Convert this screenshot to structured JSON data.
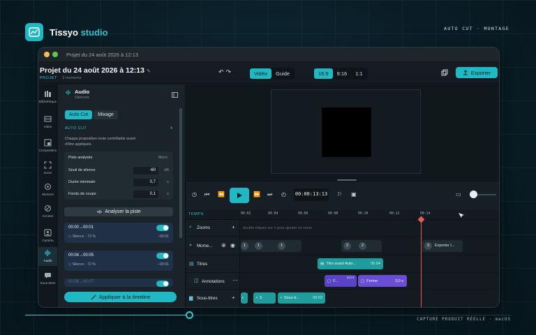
{
  "brand": {
    "name_main": "Tissyo",
    "name_accent": "studio"
  },
  "top_tag": "AUTO CUT · MONTAGE",
  "bottom_tag": "CAPTURE PRODUIT RÉELLE · macOS",
  "window": {
    "title": "Projet du 24 août 2026 à 12:13"
  },
  "header": {
    "project_title": "Projet du 24 août 2026 à 12:13",
    "project_tag": "PROJET",
    "project_meta": "3 moments",
    "view_tabs": [
      "Vidéo",
      "Guide"
    ],
    "active_view": "Vidéo",
    "ratios": [
      "16:9",
      "9:16",
      "1:1"
    ],
    "active_ratio": "16:9",
    "export_label": "Exporter"
  },
  "rail": [
    {
      "label": "Bibliothèque",
      "icon": "library-icon"
    },
    {
      "label": "Vidéo",
      "icon": "film-icon"
    },
    {
      "label": "Composition",
      "icon": "layout-icon"
    },
    {
      "label": "Zoom",
      "icon": "zoom-frame-icon"
    },
    {
      "label": "Moment",
      "icon": "target-icon"
    },
    {
      "label": "Annoter",
      "icon": "pen-icon"
    },
    {
      "label": "Caméra",
      "icon": "camera-icon"
    },
    {
      "label": "Audio",
      "icon": "audio-wave-icon"
    },
    {
      "label": "Sous-titres",
      "icon": "subtitles-icon"
    }
  ],
  "panel": {
    "title": "Audio",
    "subtitle": "Silences",
    "tabs": [
      "Auto Cut",
      "Mixage"
    ],
    "active_tab": "Auto Cut",
    "section_label": "AUTO CUT",
    "section_count": "4",
    "description": "Chaque proposition reste contrôlable avant d'être appliquée.",
    "track_label": "Piste analysée",
    "track_value": "Micro",
    "params": [
      {
        "label": "Seuil de silence",
        "value": "-60",
        "unit": "dB"
      },
      {
        "label": "Durée minimale",
        "value": "0,7",
        "unit": "s"
      },
      {
        "label": "Fondu de coupe",
        "value": "0,1",
        "unit": "s"
      }
    ],
    "analyse_label": "Analyser la piste",
    "segments": [
      {
        "time": "00:00→00:01",
        "type": "Silence · 72 %",
        "duration": "−00:01"
      },
      {
        "time": "00:04→00:05",
        "type": "Silence · 72 %",
        "duration": "−00:01"
      },
      {
        "time": "00:06→00:07",
        "type": "",
        "duration": ""
      }
    ],
    "apply_label": "Appliquer à la timeline"
  },
  "transport": {
    "timecode": "00:00:13:13",
    "zoom_level": 0.1
  },
  "timeline": {
    "header_label": "TEMPS",
    "ruler": [
      "00:02",
      "00:04",
      "00:06",
      "00:08",
      "00:10",
      "00:12",
      "00:14"
    ],
    "tracks": {
      "zooms": {
        "label": "Zooms",
        "hint": "double-cliquez sur + pour ajouter un zoom"
      },
      "moments": {
        "label": "Mome...",
        "numbers": [
          "1",
          "1",
          "1",
          "2",
          "2",
          "3"
        ],
        "moment3_label": "Exporter l..."
      },
      "titres": {
        "label": "Titres",
        "clip_label": "Titre avant Auto...",
        "clip_time": "00:04"
      },
      "annotations": {
        "label": "Annotations",
        "clip1_label": "F...",
        "clip1_time": "2,0 s",
        "clip2_label": "Forme",
        "clip2_time": "3,0 s"
      },
      "subtitles": {
        "label": "Sous-titres",
        "clip1_label": "S",
        "clip2_label": "Sous-ti...",
        "clip2_time": "00:03"
      }
    }
  },
  "colors": {
    "accent": "#20b8c2",
    "playhead": "#e25b5b",
    "annotation": "#6a4fd6",
    "titles": "#1f9c9c"
  }
}
